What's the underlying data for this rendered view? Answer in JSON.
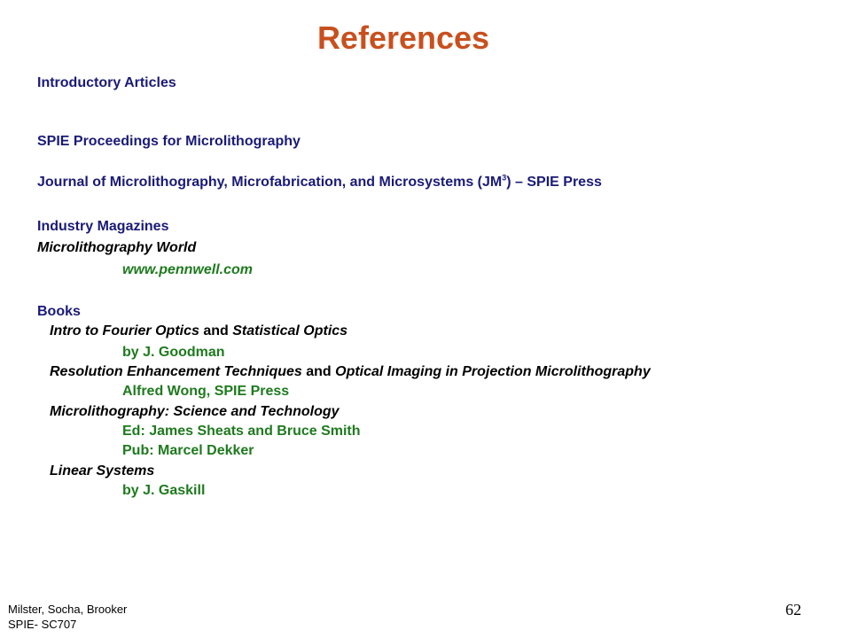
{
  "slide": {
    "title": "References",
    "section_intro": "Introductory Articles",
    "spie_proceedings": "SPIE Proceedings for Microlithography",
    "journal_prefix": "Journal of Microlithography, Microfabrication, and Microsystems (JM",
    "journal_sup": "3",
    "journal_suffix": ") – SPIE Press",
    "industry_heading": "Industry Magazines",
    "magazine_title": "Microlithography World",
    "magazine_url": "www.pennwell.com",
    "books_heading": "Books",
    "books": [
      {
        "title_a": "Intro to Fourier Optics",
        "joiner": " and ",
        "title_b": "Statistical Optics",
        "details": [
          "by J. Goodman"
        ]
      },
      {
        "title_a": "Resolution Enhancement Techniques",
        "joiner": " and ",
        "title_b": "Optical Imaging in Projection Microlithography",
        "details": [
          "Alfred Wong, SPIE Press"
        ]
      },
      {
        "title_a": "Microlithography: Science and Technology",
        "details": [
          "Ed: James Sheats and Bruce Smith",
          "Pub: Marcel Dekker"
        ]
      },
      {
        "title_a": "Linear Systems",
        "details": [
          "by J. Gaskill"
        ]
      }
    ]
  },
  "footer": {
    "authors": "Milster, Socha, Brooker",
    "course": "SPIE- SC707",
    "page_number": "62"
  },
  "colors": {
    "title": "#c8501e",
    "heading": "#1a1a78",
    "detail": "#1e7a1e"
  }
}
